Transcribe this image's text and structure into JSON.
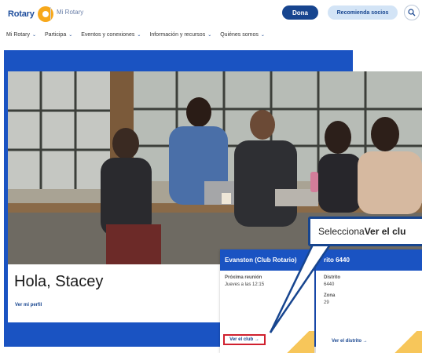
{
  "header": {
    "logo_text": "Rotary",
    "site_name": "Mi Rotary",
    "donate_label": "Dona",
    "recommend_label": "Recomienda socios",
    "search_icon": "search-icon"
  },
  "nav": [
    {
      "label": "Mi Rotary"
    },
    {
      "label": "Participa"
    },
    {
      "label": "Eventos y conexiones"
    },
    {
      "label": "Información y recursos"
    },
    {
      "label": "Quiénes somos"
    }
  ],
  "hero": {
    "greeting": "Hola, Stacey",
    "profile_link": "Ver mi perfil"
  },
  "club_card": {
    "title": "Evanston (Club Rotario)",
    "next_meeting_label": "Próxima reunión",
    "next_meeting_value": "Jueves a las 12:15",
    "link": "Ver el club →"
  },
  "district_card": {
    "title": "rito 6440",
    "district_label": "Distrito",
    "district_value": "6440",
    "zone_label": "Zona",
    "zone_value": "29",
    "link": "Ver el distrito →"
  },
  "callout": {
    "prefix": "Selecciona ",
    "bold": "Ver el clu"
  },
  "colors": {
    "brand_blue": "#17458f",
    "hero_blue": "#1a53c2",
    "gold": "#f7a81b",
    "highlight_red": "#d0202e"
  }
}
